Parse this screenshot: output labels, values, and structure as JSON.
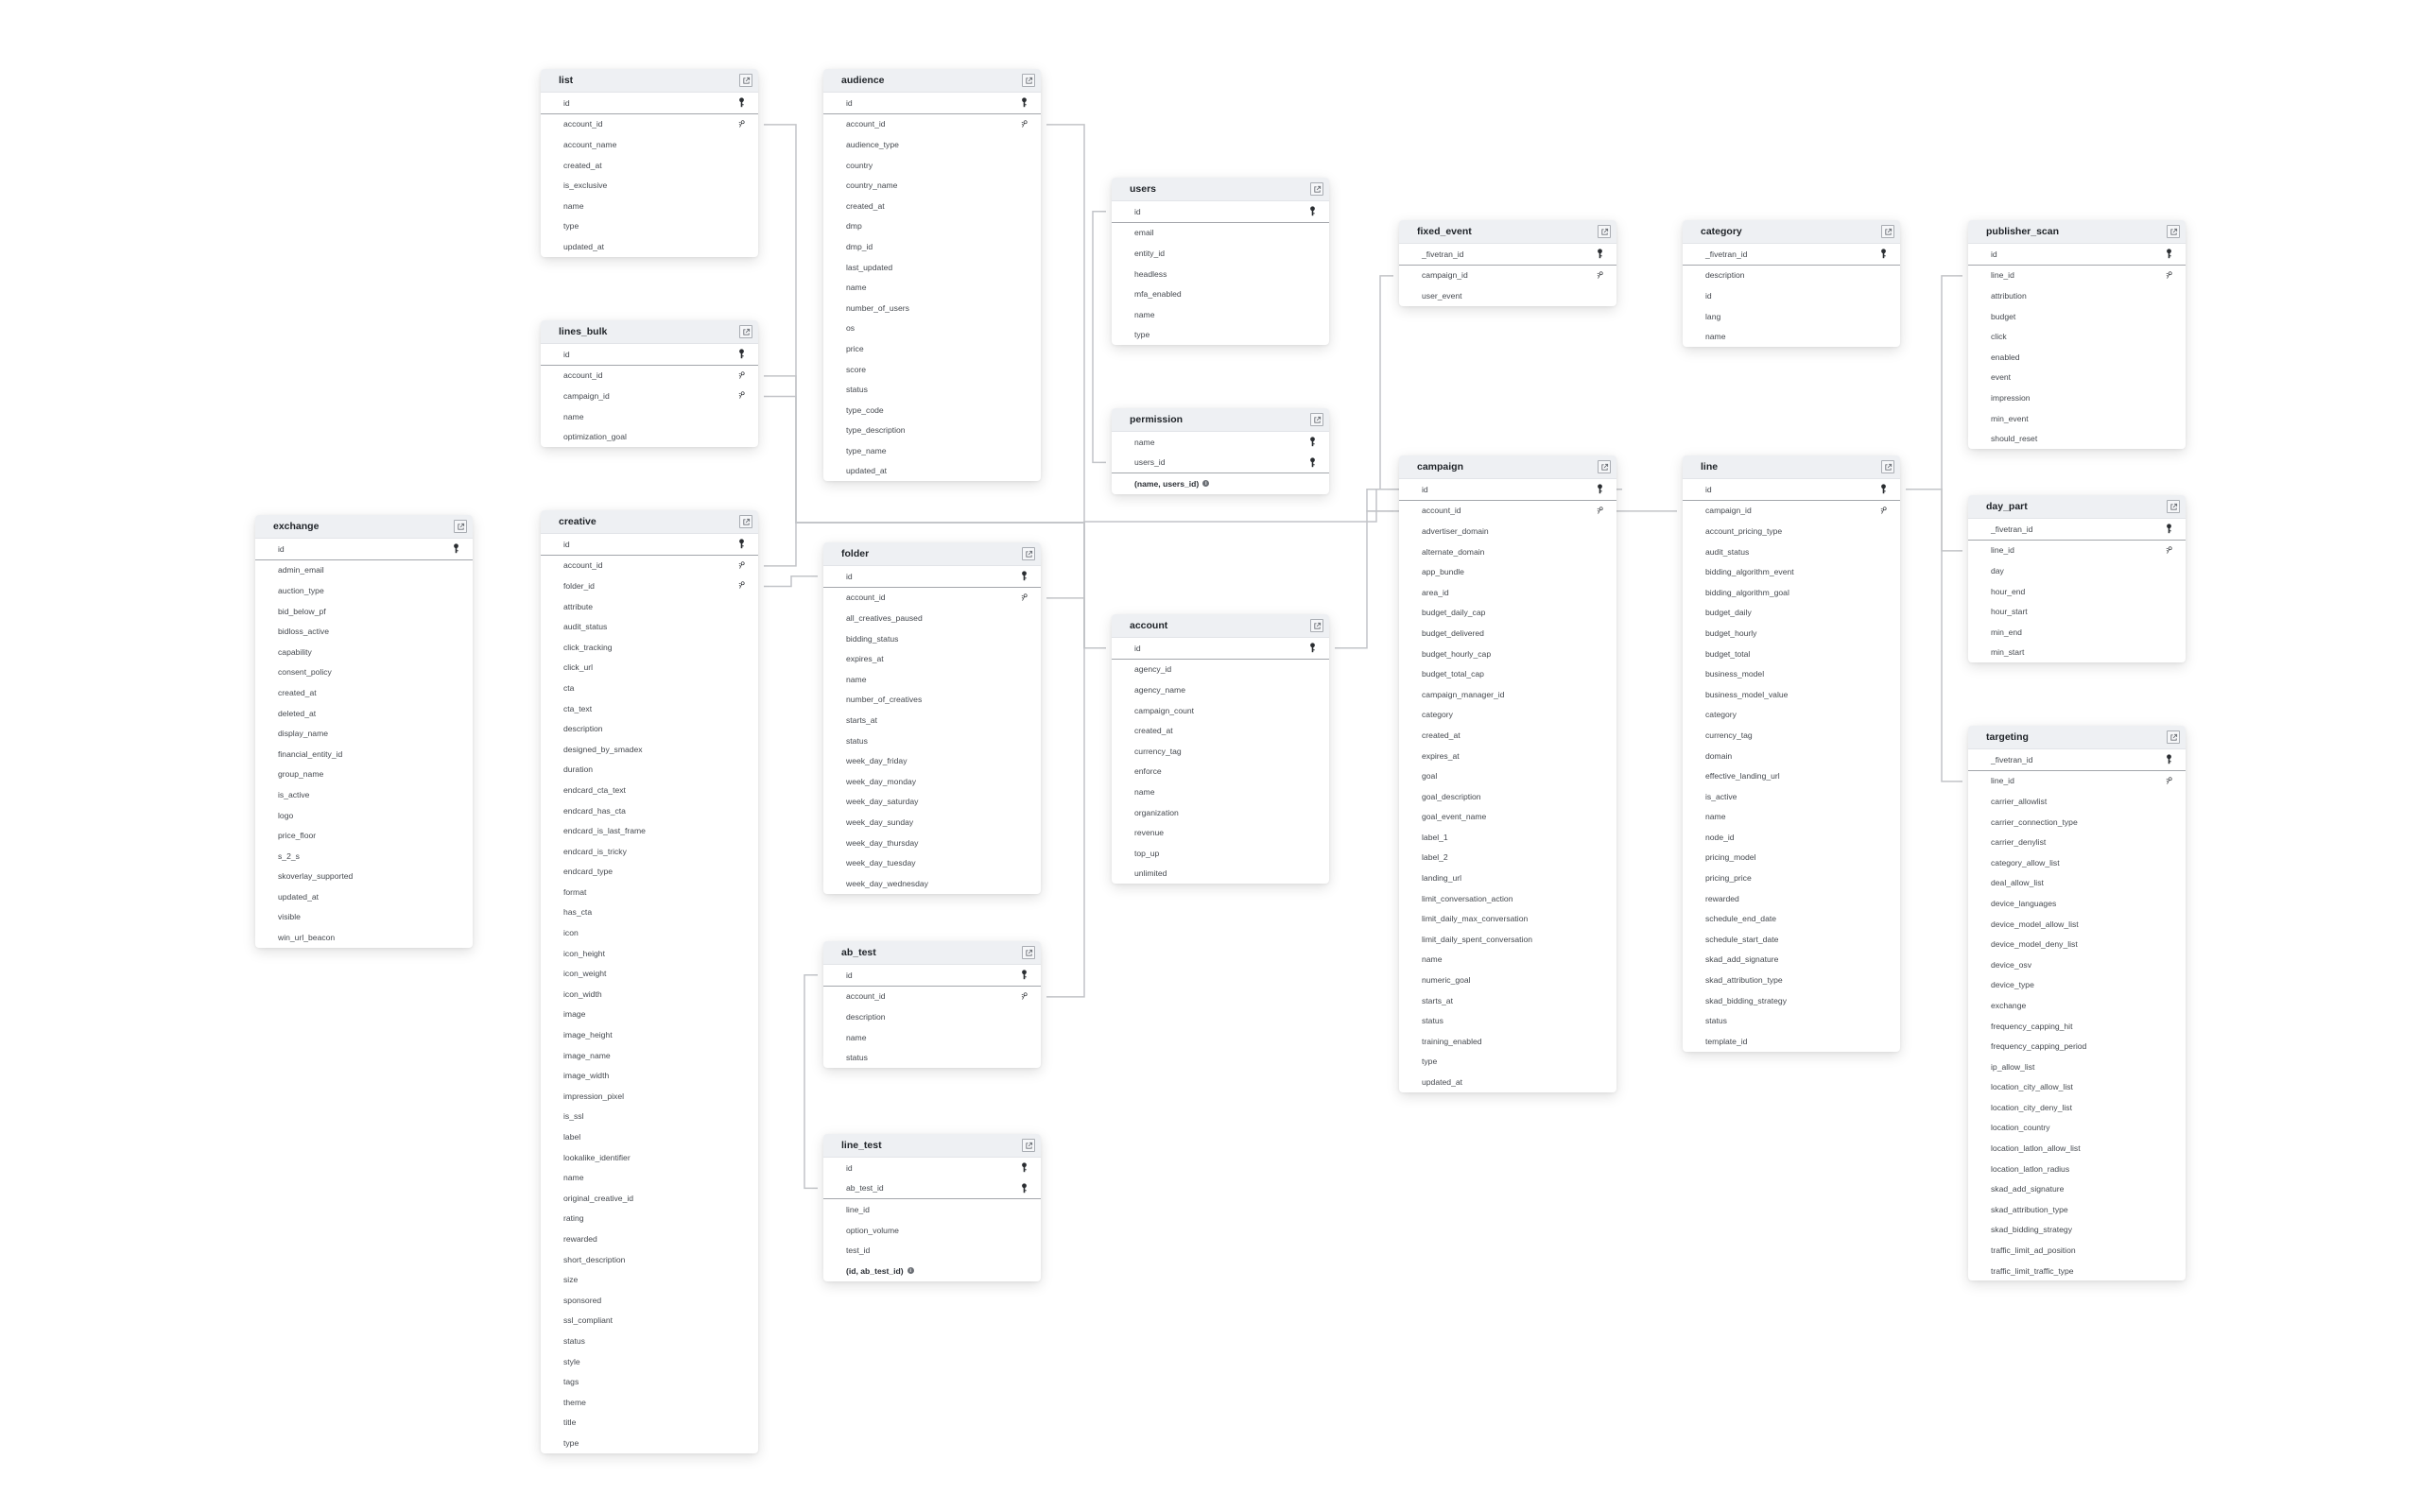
{
  "diagram": {
    "line_color": "#c2c4c8",
    "header_bg": "#eef0f3",
    "tables": [
      {
        "name": "list",
        "pk": [
          "id"
        ],
        "fk": [
          "account_id"
        ],
        "columns": [
          "account_id",
          "account_name",
          "created_at",
          "is_exclusive",
          "name",
          "type",
          "updated_at"
        ]
      },
      {
        "name": "lines_bulk",
        "pk": [
          "id"
        ],
        "fk": [
          "account_id",
          "campaign_id"
        ],
        "columns": [
          "account_id",
          "campaign_id",
          "name",
          "optimization_goal"
        ]
      },
      {
        "name": "exchange",
        "pk": [
          "id"
        ],
        "fk": [],
        "columns": [
          "admin_email",
          "auction_type",
          "bid_below_pf",
          "bidloss_active",
          "capability",
          "consent_policy",
          "created_at",
          "deleted_at",
          "display_name",
          "financial_entity_id",
          "group_name",
          "is_active",
          "logo",
          "price_floor",
          "s_2_s",
          "skoverlay_supported",
          "updated_at",
          "visible",
          "win_url_beacon"
        ]
      },
      {
        "name": "creative",
        "pk": [
          "id"
        ],
        "fk": [
          "account_id",
          "folder_id"
        ],
        "columns": [
          "account_id",
          "folder_id",
          "attribute",
          "audit_status",
          "click_tracking",
          "click_url",
          "cta",
          "cta_text",
          "description",
          "designed_by_smadex",
          "duration",
          "endcard_cta_text",
          "endcard_has_cta",
          "endcard_is_last_frame",
          "endcard_is_tricky",
          "endcard_type",
          "format",
          "has_cta",
          "icon",
          "icon_height",
          "icon_weight",
          "icon_width",
          "image",
          "image_height",
          "image_name",
          "image_width",
          "impression_pixel",
          "is_ssl",
          "label",
          "lookalike_identifier",
          "name",
          "original_creative_id",
          "rating",
          "rewarded",
          "short_description",
          "size",
          "sponsored",
          "ssl_compliant",
          "status",
          "style",
          "tags",
          "theme",
          "title",
          "type"
        ]
      },
      {
        "name": "audience",
        "pk": [
          "id"
        ],
        "fk": [
          "account_id"
        ],
        "columns": [
          "account_id",
          "audience_type",
          "country",
          "country_name",
          "created_at",
          "dmp",
          "dmp_id",
          "last_updated",
          "name",
          "number_of_users",
          "os",
          "price",
          "score",
          "status",
          "type_code",
          "type_description",
          "type_name",
          "updated_at"
        ]
      },
      {
        "name": "folder",
        "pk": [
          "id"
        ],
        "fk": [
          "account_id"
        ],
        "columns": [
          "account_id",
          "all_creatives_paused",
          "bidding_status",
          "expires_at",
          "name",
          "number_of_creatives",
          "starts_at",
          "status",
          "week_day_friday",
          "week_day_monday",
          "week_day_saturday",
          "week_day_sunday",
          "week_day_thursday",
          "week_day_tuesday",
          "week_day_wednesday"
        ]
      },
      {
        "name": "ab_test",
        "pk": [
          "id"
        ],
        "fk": [
          "account_id"
        ],
        "columns": [
          "account_id",
          "description",
          "name",
          "status"
        ]
      },
      {
        "name": "line_test",
        "pk": [
          "id",
          "ab_test_id"
        ],
        "fk": [],
        "columns": [
          "line_id",
          "option_volume",
          "test_id"
        ],
        "composite": "(id, ab_test_id)"
      },
      {
        "name": "users",
        "pk": [
          "id"
        ],
        "fk": [],
        "columns": [
          "email",
          "entity_id",
          "headless",
          "mfa_enabled",
          "name",
          "type"
        ]
      },
      {
        "name": "permission",
        "pk": [
          "name",
          "users_id"
        ],
        "fk": [],
        "columns": [],
        "composite": "(name, users_id)"
      },
      {
        "name": "account",
        "pk": [
          "id"
        ],
        "fk": [],
        "columns": [
          "agency_id",
          "agency_name",
          "campaign_count",
          "created_at",
          "currency_tag",
          "enforce",
          "name",
          "organization",
          "revenue",
          "top_up",
          "unlimited"
        ]
      },
      {
        "name": "fixed_event",
        "pk": [
          "_fivetran_id"
        ],
        "fk": [
          "campaign_id"
        ],
        "columns": [
          "campaign_id",
          "user_event"
        ]
      },
      {
        "name": "campaign",
        "pk": [
          "id"
        ],
        "fk": [
          "account_id"
        ],
        "columns": [
          "account_id",
          "advertiser_domain",
          "alternate_domain",
          "app_bundle",
          "area_id",
          "budget_daily_cap",
          "budget_delivered",
          "budget_hourly_cap",
          "budget_total_cap",
          "campaign_manager_id",
          "category",
          "created_at",
          "expires_at",
          "goal",
          "goal_description",
          "goal_event_name",
          "label_1",
          "label_2",
          "landing_url",
          "limit_conversation_action",
          "limit_daily_max_conversation",
          "limit_daily_spent_conversation",
          "name",
          "numeric_goal",
          "starts_at",
          "status",
          "training_enabled",
          "type",
          "updated_at"
        ]
      },
      {
        "name": "category",
        "pk": [
          "_fivetran_id"
        ],
        "fk": [],
        "columns": [
          "description",
          "id",
          "lang",
          "name"
        ]
      },
      {
        "name": "line",
        "pk": [
          "id"
        ],
        "fk": [
          "campaign_id"
        ],
        "columns": [
          "campaign_id",
          "account_pricing_type",
          "audit_status",
          "bidding_algorithm_event",
          "bidding_algorithm_goal",
          "budget_daily",
          "budget_hourly",
          "budget_total",
          "business_model",
          "business_model_value",
          "category",
          "currency_tag",
          "domain",
          "effective_landing_url",
          "is_active",
          "name",
          "node_id",
          "pricing_model",
          "pricing_price",
          "rewarded",
          "schedule_end_date",
          "schedule_start_date",
          "skad_add_signature",
          "skad_attribution_type",
          "skad_bidding_strategy",
          "status",
          "template_id"
        ]
      },
      {
        "name": "publisher_scan",
        "pk": [
          "id"
        ],
        "fk": [
          "line_id"
        ],
        "columns": [
          "line_id",
          "attribution",
          "budget",
          "click",
          "enabled",
          "event",
          "impression",
          "min_event",
          "should_reset"
        ]
      },
      {
        "name": "day_part",
        "pk": [
          "_fivetran_id"
        ],
        "fk": [
          "line_id"
        ],
        "columns": [
          "line_id",
          "day",
          "hour_end",
          "hour_start",
          "min_end",
          "min_start"
        ]
      },
      {
        "name": "targeting",
        "pk": [
          "_fivetran_id"
        ],
        "fk": [
          "line_id"
        ],
        "columns": [
          "line_id",
          "carrier_allowlist",
          "carrier_connection_type",
          "carrier_denylist",
          "category_allow_list",
          "deal_allow_list",
          "device_languages",
          "device_model_allow_list",
          "device_model_deny_list",
          "device_osv",
          "device_type",
          "exchange",
          "frequency_capping_hit",
          "frequency_capping_period",
          "ip_allow_list",
          "location_city_allow_list",
          "location_city_deny_list",
          "location_country",
          "location_latlon_allow_list",
          "location_latlon_radius",
          "skad_add_signature",
          "skad_attribution_type",
          "skad_bidding_strategy",
          "traffic_limit_ad_position",
          "traffic_limit_traffic_type"
        ]
      }
    ],
    "relations": [
      {
        "from": "list.account_id",
        "to": "account.id"
      },
      {
        "from": "lines_bulk.account_id",
        "to": "account.id"
      },
      {
        "from": "lines_bulk.campaign_id",
        "to": "campaign.id"
      },
      {
        "from": "audience.account_id",
        "to": "account.id"
      },
      {
        "from": "creative.account_id",
        "to": "account.id"
      },
      {
        "from": "creative.folder_id",
        "to": "folder.id"
      },
      {
        "from": "folder.account_id",
        "to": "account.id"
      },
      {
        "from": "ab_test.account_id",
        "to": "account.id"
      },
      {
        "from": "line_test.ab_test_id",
        "to": "ab_test.id"
      },
      {
        "from": "permission.users_id",
        "to": "users.id"
      },
      {
        "from": "fixed_event.campaign_id",
        "to": "campaign.id"
      },
      {
        "from": "campaign.account_id",
        "to": "account.id"
      },
      {
        "from": "line.campaign_id",
        "to": "campaign.id"
      },
      {
        "from": "publisher_scan.line_id",
        "to": "line.id"
      },
      {
        "from": "day_part.line_id",
        "to": "line.id"
      },
      {
        "from": "targeting.line_id",
        "to": "line.id"
      }
    ]
  }
}
